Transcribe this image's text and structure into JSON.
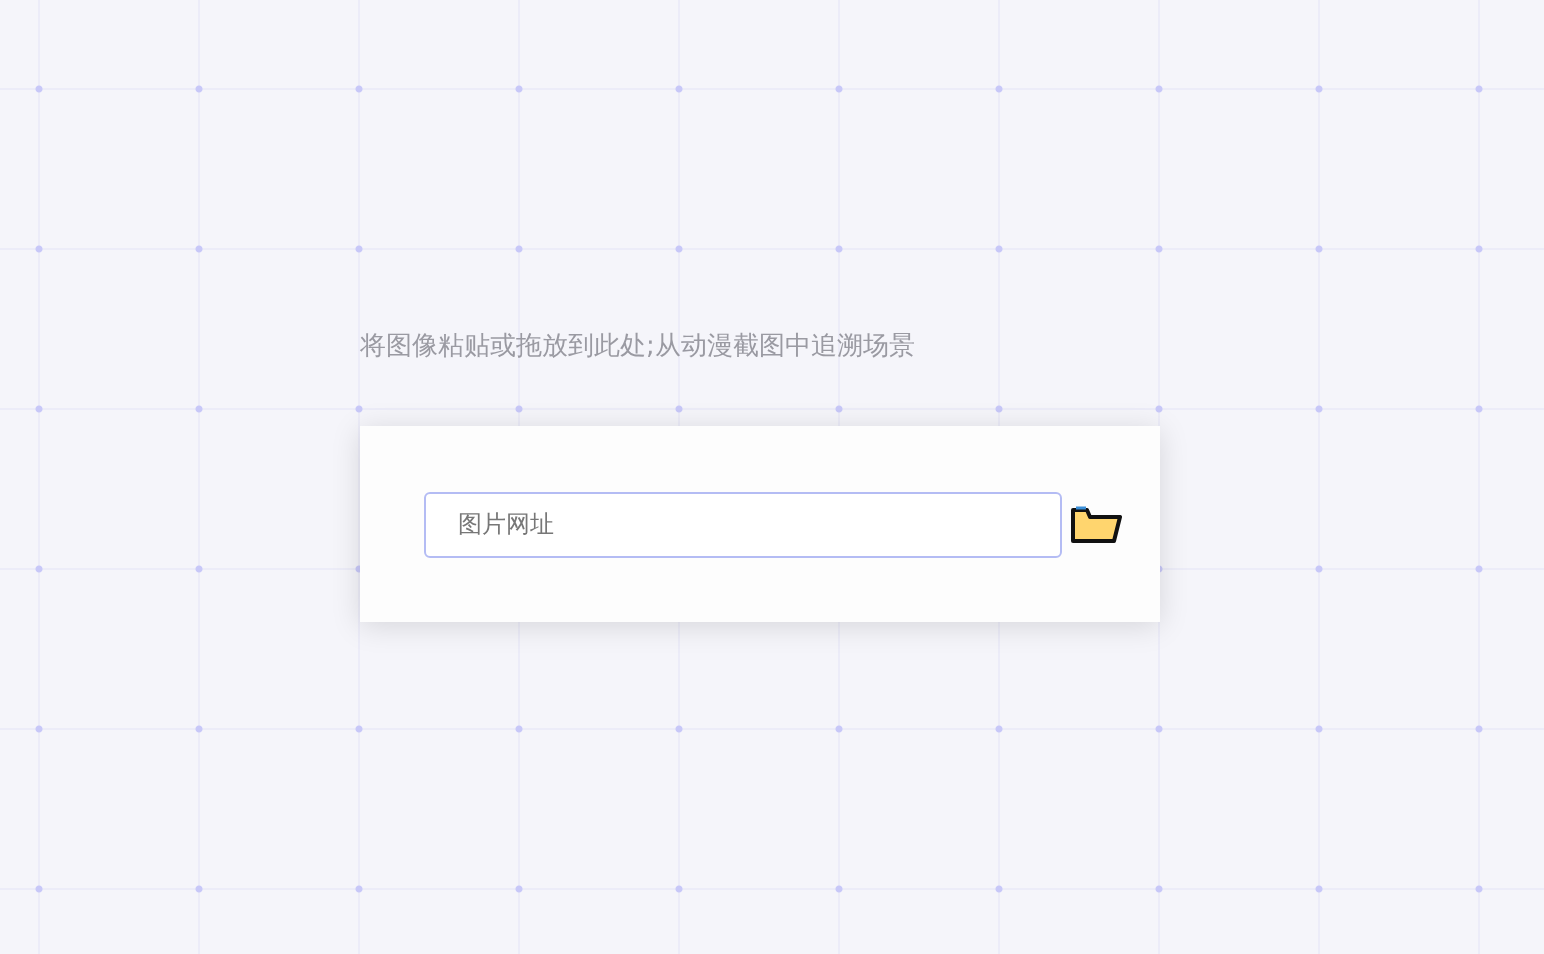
{
  "hint": "将图像粘贴或拖放到此处;从动漫截图中追溯场景",
  "url_field": {
    "placeholder": "图片网址"
  }
}
